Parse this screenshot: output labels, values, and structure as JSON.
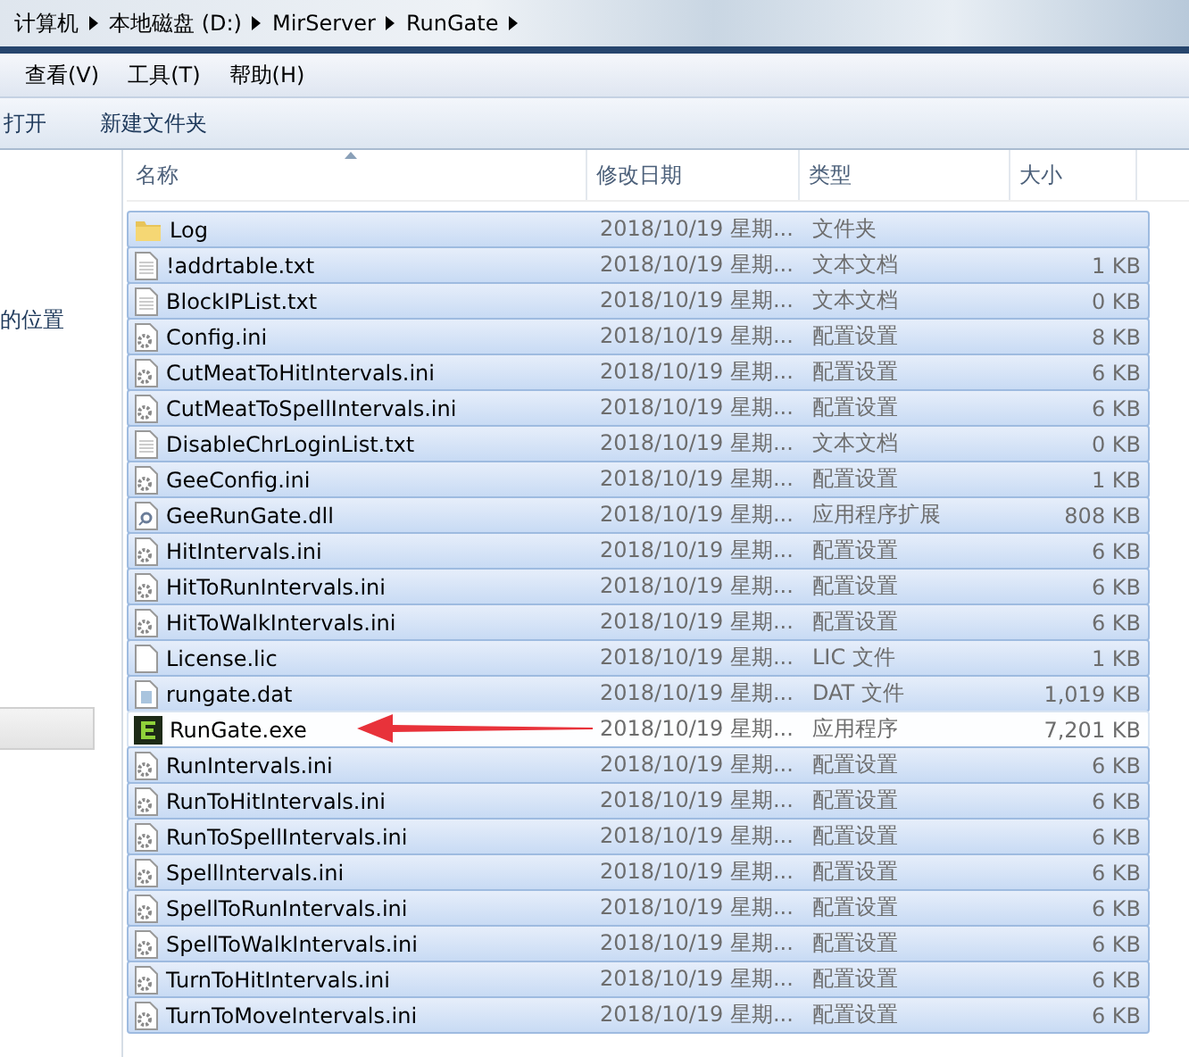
{
  "breadcrumb": [
    "计算机",
    "本地磁盘 (D:)",
    "MirServer",
    "RunGate"
  ],
  "menu": [
    "查看(V)",
    "工具(T)",
    "帮助(H)"
  ],
  "toolbar": [
    "打开",
    "新建文件夹"
  ],
  "nav_pane": {
    "items": [
      {
        "label": "的位置",
        "selected": false
      },
      {
        "selected": true
      }
    ]
  },
  "table": {
    "columns": [
      "名称",
      "修改日期",
      "类型",
      "大小"
    ],
    "rows": [
      {
        "name": "Log",
        "date": "2018/10/19 星期...",
        "type": "文件夹",
        "size": "",
        "kind": "folder",
        "selected": true
      },
      {
        "name": "!addrtable.txt",
        "date": "2018/10/19 星期...",
        "type": "文本文档",
        "size": "1 KB",
        "kind": "text",
        "selected": true
      },
      {
        "name": "BlockIPList.txt",
        "date": "2018/10/19 星期...",
        "type": "文本文档",
        "size": "0 KB",
        "kind": "text",
        "selected": true
      },
      {
        "name": "Config.ini",
        "date": "2018/10/19 星期...",
        "type": "配置设置",
        "size": "8 KB",
        "kind": "config",
        "selected": true
      },
      {
        "name": "CutMeatToHitIntervals.ini",
        "date": "2018/10/19 星期...",
        "type": "配置设置",
        "size": "6 KB",
        "kind": "config",
        "selected": true
      },
      {
        "name": "CutMeatToSpellIntervals.ini",
        "date": "2018/10/19 星期...",
        "type": "配置设置",
        "size": "6 KB",
        "kind": "config",
        "selected": true
      },
      {
        "name": "DisableChrLoginList.txt",
        "date": "2018/10/19 星期...",
        "type": "文本文档",
        "size": "0 KB",
        "kind": "text",
        "selected": true
      },
      {
        "name": "GeeConfig.ini",
        "date": "2018/10/19 星期...",
        "type": "配置设置",
        "size": "1 KB",
        "kind": "config",
        "selected": true
      },
      {
        "name": "GeeRunGate.dll",
        "date": "2018/10/19 星期...",
        "type": "应用程序扩展",
        "size": "808 KB",
        "kind": "dll",
        "selected": true
      },
      {
        "name": "HitIntervals.ini",
        "date": "2018/10/19 星期...",
        "type": "配置设置",
        "size": "6 KB",
        "kind": "config",
        "selected": true
      },
      {
        "name": "HitToRunIntervals.ini",
        "date": "2018/10/19 星期...",
        "type": "配置设置",
        "size": "6 KB",
        "kind": "config",
        "selected": true
      },
      {
        "name": "HitToWalkIntervals.ini",
        "date": "2018/10/19 星期...",
        "type": "配置设置",
        "size": "6 KB",
        "kind": "config",
        "selected": true
      },
      {
        "name": "License.lic",
        "date": "2018/10/19 星期...",
        "type": "LIC 文件",
        "size": "1 KB",
        "kind": "file",
        "selected": true
      },
      {
        "name": "rungate.dat",
        "date": "2018/10/19 星期...",
        "type": "DAT 文件",
        "size": "1,019 KB",
        "kind": "dat",
        "selected": true
      },
      {
        "name": "RunGate.exe",
        "date": "2018/10/19 星期...",
        "type": "应用程序",
        "size": "7,201 KB",
        "kind": "exe",
        "selected": false
      },
      {
        "name": "RunIntervals.ini",
        "date": "2018/10/19 星期...",
        "type": "配置设置",
        "size": "6 KB",
        "kind": "config",
        "selected": true
      },
      {
        "name": "RunToHitIntervals.ini",
        "date": "2018/10/19 星期...",
        "type": "配置设置",
        "size": "6 KB",
        "kind": "config",
        "selected": true
      },
      {
        "name": "RunToSpellIntervals.ini",
        "date": "2018/10/19 星期...",
        "type": "配置设置",
        "size": "6 KB",
        "kind": "config",
        "selected": true
      },
      {
        "name": "SpellIntervals.ini",
        "date": "2018/10/19 星期...",
        "type": "配置设置",
        "size": "6 KB",
        "kind": "config",
        "selected": true
      },
      {
        "name": "SpellToRunIntervals.ini",
        "date": "2018/10/19 星期...",
        "type": "配置设置",
        "size": "6 KB",
        "kind": "config",
        "selected": true
      },
      {
        "name": "SpellToWalkIntervals.ini",
        "date": "2018/10/19 星期...",
        "type": "配置设置",
        "size": "6 KB",
        "kind": "config",
        "selected": true
      },
      {
        "name": "TurnToHitIntervals.ini",
        "date": "2018/10/19 星期...",
        "type": "配置设置",
        "size": "6 KB",
        "kind": "config",
        "selected": true
      },
      {
        "name": "TurnToMoveIntervals.ini",
        "date": "2018/10/19 星期...",
        "type": "配置设置",
        "size": "6 KB",
        "kind": "config",
        "selected": true
      }
    ]
  }
}
